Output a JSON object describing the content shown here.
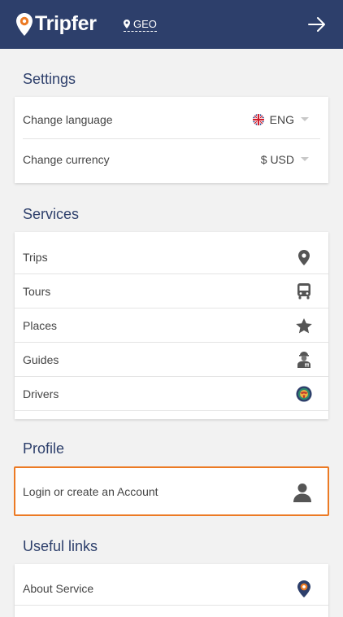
{
  "header": {
    "brand": "Tripfer",
    "region": "GEO"
  },
  "settings": {
    "title": "Settings",
    "language_label": "Change language",
    "language_value": "ENG",
    "currency_label": "Change currency",
    "currency_value": "$ USD"
  },
  "services": {
    "title": "Services",
    "items": [
      {
        "label": "Trips",
        "icon": "map-pin-icon"
      },
      {
        "label": "Tours",
        "icon": "bus-icon"
      },
      {
        "label": "Places",
        "icon": "star-icon"
      },
      {
        "label": "Guides",
        "icon": "guide-icon"
      },
      {
        "label": "Drivers",
        "icon": "steering-wheel-icon"
      }
    ]
  },
  "profile": {
    "title": "Profile",
    "login_label": "Login or create an Account",
    "accent": "#ec7a24"
  },
  "useful_links": {
    "title": "Useful links",
    "items": [
      {
        "label": "About Service",
        "icon": "tripfer-pin-icon"
      }
    ]
  },
  "colors": {
    "header_bg": "#2d3f6b",
    "brand_accent": "#ec7a24"
  }
}
